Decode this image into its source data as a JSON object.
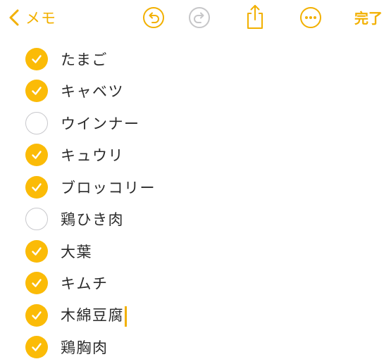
{
  "toolbar": {
    "back_label": "メモ",
    "done_label": "完了",
    "icons": [
      "chevron-left-icon",
      "undo-icon",
      "redo-icon",
      "share-icon",
      "more-icon"
    ],
    "accent_color": "#f2b000",
    "disabled_color": "#c6c6c8"
  },
  "checklist": {
    "items": [
      {
        "label": "たまご",
        "checked": true
      },
      {
        "label": "キャベツ",
        "checked": true
      },
      {
        "label": "ウインナー",
        "checked": false
      },
      {
        "label": "キュウリ",
        "checked": true
      },
      {
        "label": "ブロッコリー",
        "checked": true
      },
      {
        "label": "鶏ひき肉",
        "checked": false
      },
      {
        "label": "大葉",
        "checked": true
      },
      {
        "label": "キムチ",
        "checked": true
      },
      {
        "label": "木綿豆腐",
        "checked": true
      },
      {
        "label": "鶏胸肉",
        "checked": true
      }
    ],
    "checked_color": "#fbbb07",
    "unchecked_border_color": "#c8c8cc"
  }
}
